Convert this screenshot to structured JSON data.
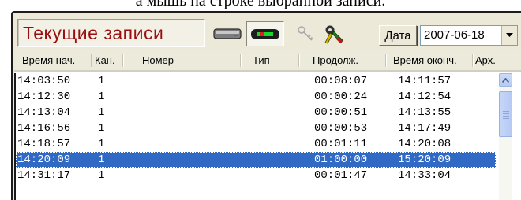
{
  "caption": "а мышь на строке выбранной записи.",
  "toolbar": {
    "title": "Текущие записи",
    "date_button_label": "Дата",
    "date_value": "2007-06-18",
    "icons": [
      "hard-drive-icon",
      "recorder-device-icon",
      "key-icon",
      "settings-tool-icon"
    ],
    "colors": {
      "title": "#9a1010",
      "selection": "#316ac5"
    }
  },
  "columns": [
    "Время нач.",
    "Кан.",
    "Номер",
    "Тип",
    "Продолж.",
    "Время оконч.",
    "Арх."
  ],
  "rows": [
    {
      "start": "14:03:50",
      "channel": "1",
      "number": "",
      "type": "",
      "duration": "00:08:07",
      "end": "14:11:57",
      "selected": false
    },
    {
      "start": "14:12:30",
      "channel": "1",
      "number": "",
      "type": "",
      "duration": "00:00:24",
      "end": "14:12:54",
      "selected": false
    },
    {
      "start": "14:13:04",
      "channel": "1",
      "number": "",
      "type": "",
      "duration": "00:00:51",
      "end": "14:13:55",
      "selected": false
    },
    {
      "start": "14:16:56",
      "channel": "1",
      "number": "",
      "type": "",
      "duration": "00:00:53",
      "end": "14:17:49",
      "selected": false
    },
    {
      "start": "14:18:57",
      "channel": "1",
      "number": "",
      "type": "",
      "duration": "00:01:11",
      "end": "14:20:08",
      "selected": false
    },
    {
      "start": "14:20:09",
      "channel": "1",
      "number": "",
      "type": "",
      "duration": "01:00:00",
      "end": "15:20:09",
      "selected": true
    },
    {
      "start": "14:31:17",
      "channel": "1",
      "number": "",
      "type": "",
      "duration": "00:01:47",
      "end": "14:33:04",
      "selected": false
    }
  ]
}
